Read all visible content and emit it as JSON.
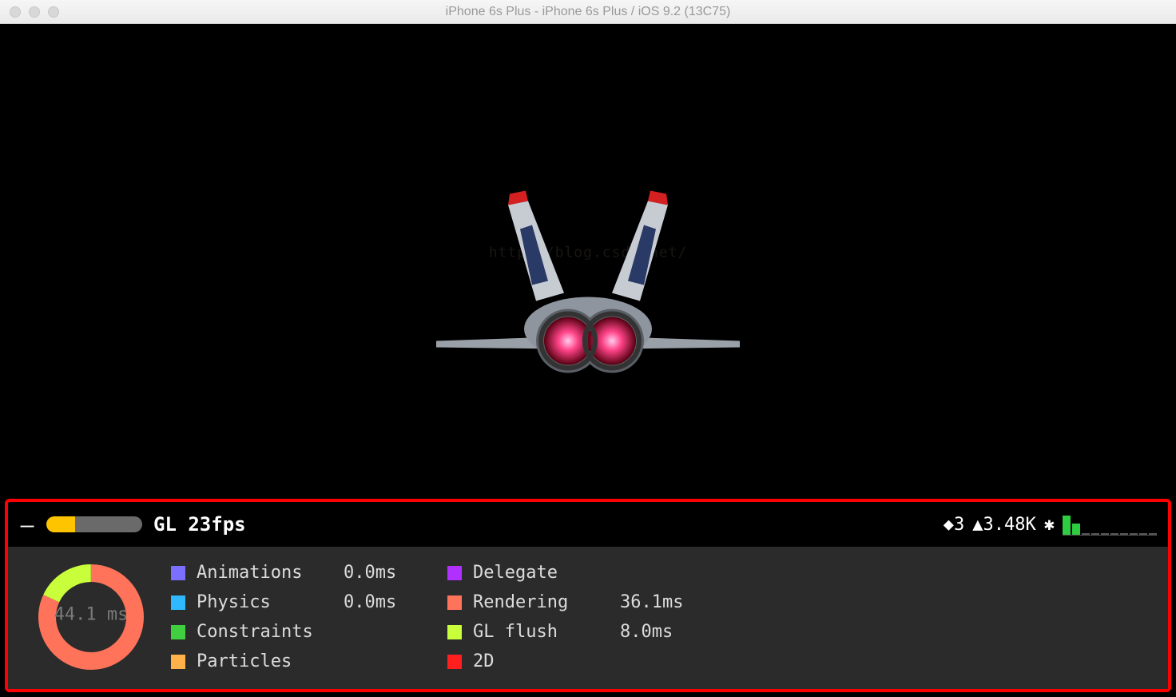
{
  "window": {
    "title": "iPhone 6s Plus - iPhone 6s Plus / iOS 9.2 (13C75)"
  },
  "watermark": "http://blog.csdn.net/",
  "debug": {
    "minus": "–",
    "fps_label": "GL 23fps",
    "fps_fill_pct": 30,
    "stat_diamond": "◆3",
    "stat_tri": "▲3.48K",
    "stat_star": "✱",
    "donut_ms": "44.1 ms",
    "legend_col1": [
      {
        "label": "Animations",
        "value": "0.0ms",
        "color": "#7a6fff"
      },
      {
        "label": "Physics",
        "value": "0.0ms",
        "color": "#2fb7ff"
      },
      {
        "label": "Constraints",
        "value": "",
        "color": "#3fcf3f"
      },
      {
        "label": "Particles",
        "value": "",
        "color": "#ffb14a"
      }
    ],
    "legend_col2": [
      {
        "label": "Delegate",
        "value": "",
        "color": "#b030ff"
      },
      {
        "label": "Rendering",
        "value": "36.1ms",
        "color": "#ff735a"
      },
      {
        "label": "GL flush",
        "value": "8.0ms",
        "color": "#c8ff3a"
      },
      {
        "label": "2D",
        "value": "",
        "color": "#ff1f1f"
      }
    ]
  }
}
